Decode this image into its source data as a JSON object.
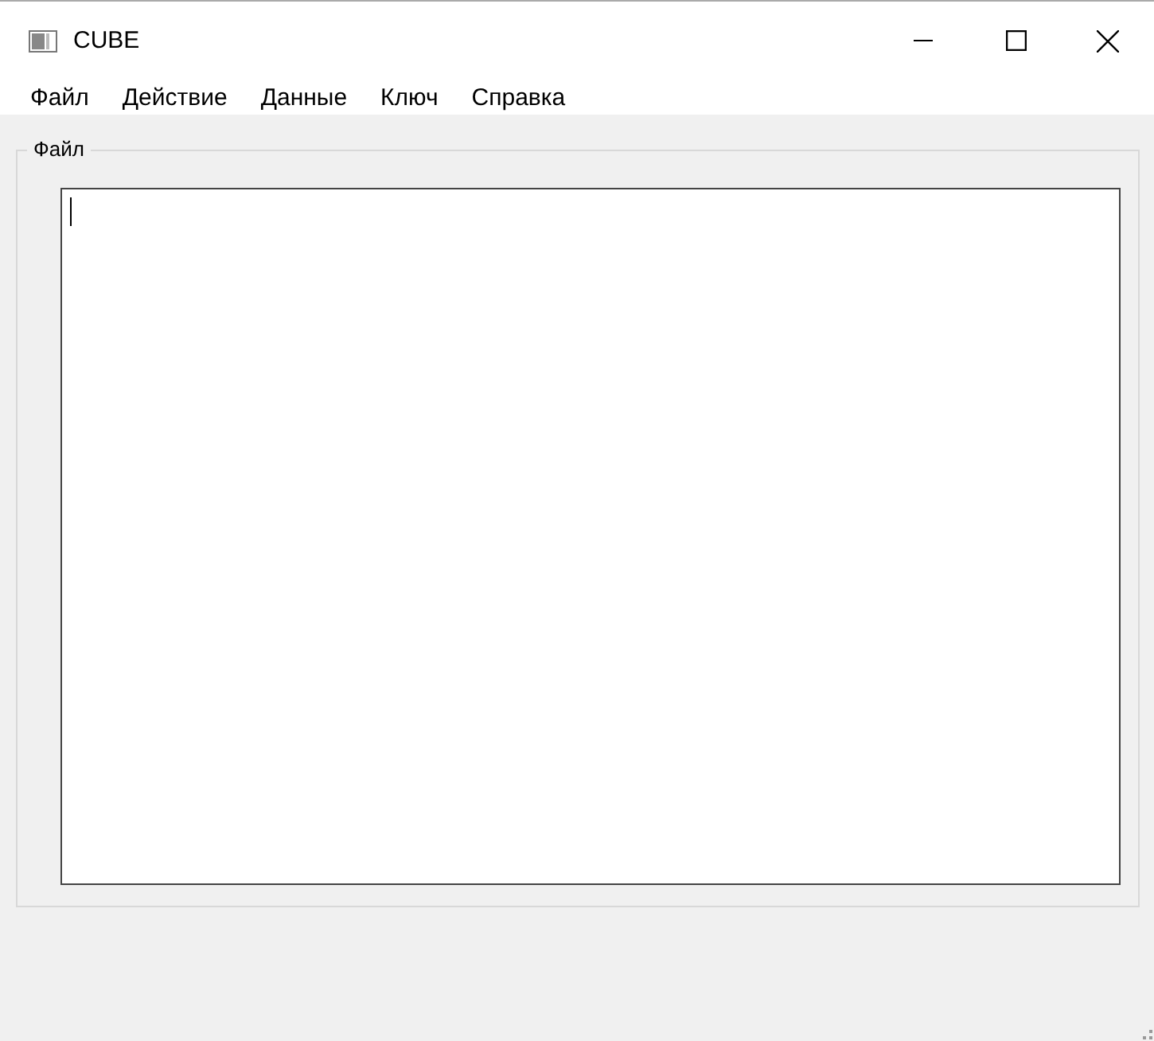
{
  "window": {
    "title": "CUBE"
  },
  "menu": [
    {
      "label": "Файл"
    },
    {
      "label": "Действие"
    },
    {
      "label": "Данные"
    },
    {
      "label": "Ключ"
    },
    {
      "label": "Справка"
    }
  ],
  "group_box": {
    "title": "Файл",
    "text_editor": {
      "focused": true
    }
  }
}
